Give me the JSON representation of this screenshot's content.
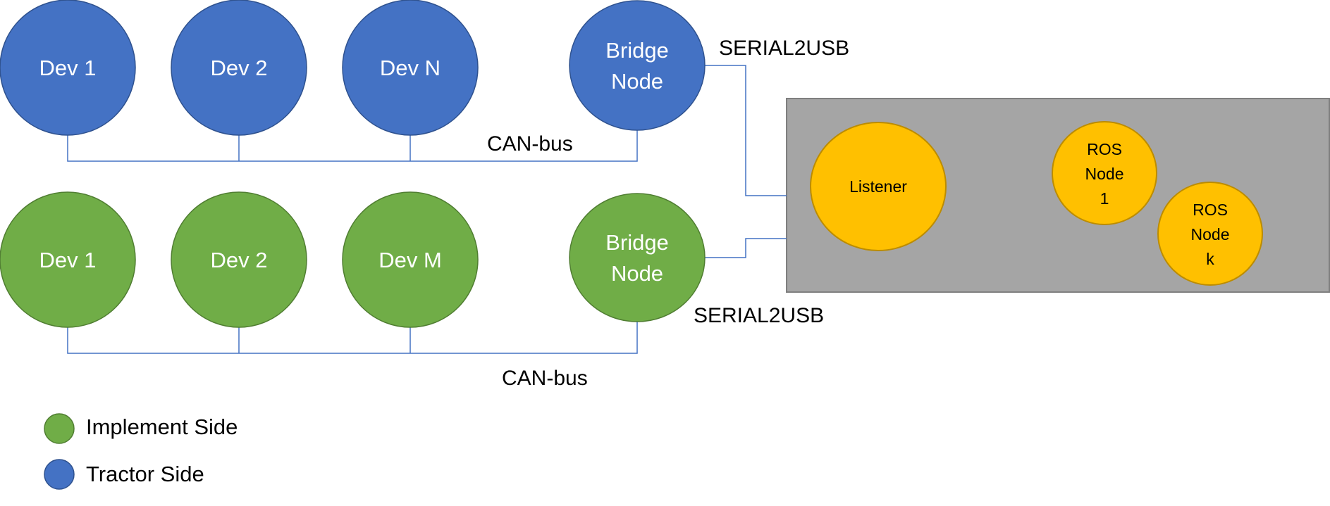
{
  "colors": {
    "tractor_fill": "#4472C4",
    "tractor_stroke": "#2F528F",
    "implement_fill": "#70AD47",
    "implement_stroke": "#507E32",
    "ros_fill": "#FFC000",
    "ros_stroke": "#BC8C00",
    "host_fill": "#A5A5A5",
    "host_stroke": "#7F7F7F",
    "wire": "#4472C4"
  },
  "tractor_side": {
    "devices": [
      "Dev 1",
      "Dev 2",
      "Dev N"
    ],
    "bridge": [
      "Bridge",
      "Node"
    ],
    "bus_label": "CAN-bus",
    "link_label": "SERIAL2USB"
  },
  "implement_side": {
    "devices": [
      "Dev 1",
      "Dev 2",
      "Dev M"
    ],
    "bridge": [
      "Bridge",
      "Node"
    ],
    "bus_label": "CAN-bus",
    "link_label": "SERIAL2USB"
  },
  "host": {
    "listener": "Listener",
    "ros_nodes": [
      [
        "ROS",
        "Node",
        "1"
      ],
      [
        "ROS",
        "Node",
        "k"
      ]
    ]
  },
  "legend": [
    {
      "label": "Implement Side",
      "side": "implement"
    },
    {
      "label": "Tractor Side",
      "side": "tractor"
    }
  ]
}
